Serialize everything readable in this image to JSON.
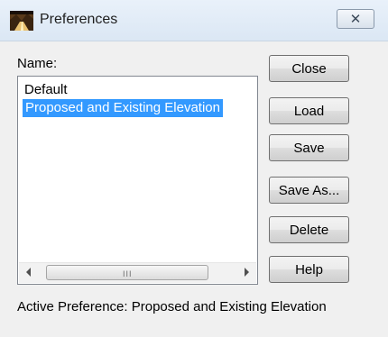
{
  "window": {
    "title": "Preferences",
    "close_glyph": "✕"
  },
  "name_label": "Name:",
  "list": {
    "items": [
      {
        "label": "Default",
        "selected": false
      },
      {
        "label": "Proposed and Existing Elevation",
        "selected": true
      }
    ]
  },
  "scrollbar": {
    "grip": "III"
  },
  "buttons": {
    "close": "Close",
    "load": "Load",
    "save": "Save",
    "save_as": "Save As...",
    "delete": "Delete",
    "help": "Help"
  },
  "status": {
    "label": "Active Preference: ",
    "value": "Proposed and Existing Elevation"
  },
  "colors": {
    "selection": "#3399ff",
    "dialog_bg": "#f0f0f0"
  },
  "icons": {
    "app": "preferences-app-icon",
    "scroll_left": "arrow-left-icon",
    "scroll_right": "arrow-right-icon"
  }
}
